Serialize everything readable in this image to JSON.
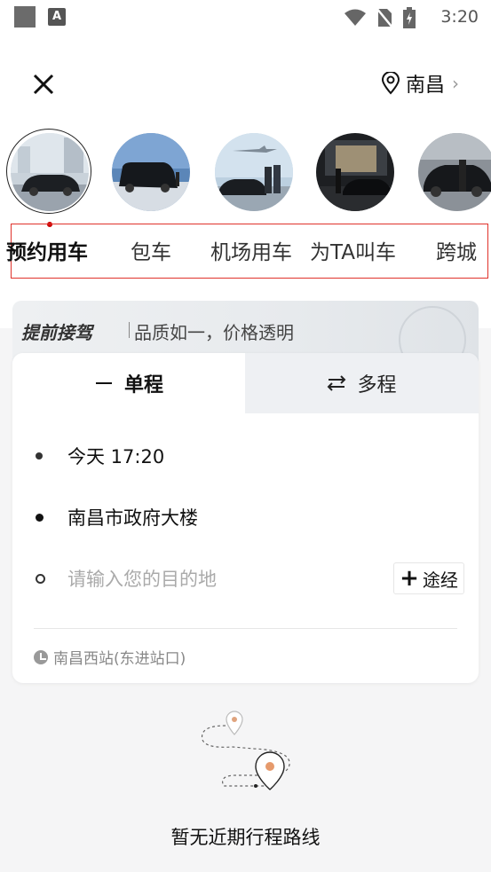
{
  "status_bar": {
    "time": "3:20",
    "app_icon_letter": "A"
  },
  "header": {
    "close_icon": "close-icon",
    "city": "南昌"
  },
  "services": [
    {
      "label": "预约用车",
      "active": true
    },
    {
      "label": "包车",
      "active": false
    },
    {
      "label": "机场用车",
      "active": false
    },
    {
      "label": "为TA叫车",
      "active": false
    },
    {
      "label": "跨城",
      "active": false
    }
  ],
  "banner": {
    "title": "提前接驾",
    "subtitle": "品质如一，价格透明"
  },
  "trip_tabs": {
    "one_way": "单程",
    "multi": "多程"
  },
  "form": {
    "time": "今天 17:20",
    "start": "南昌市政府大楼",
    "destination_placeholder": "请输入您的目的地",
    "via_label": "途经",
    "recent_place": "南昌西站(东进站口)"
  },
  "empty_state": {
    "text": "暂无近期行程路线"
  },
  "colors": {
    "highlight_border": "#e0322b",
    "background": "#f5f5f6",
    "accent_dot": "#c0392b"
  }
}
